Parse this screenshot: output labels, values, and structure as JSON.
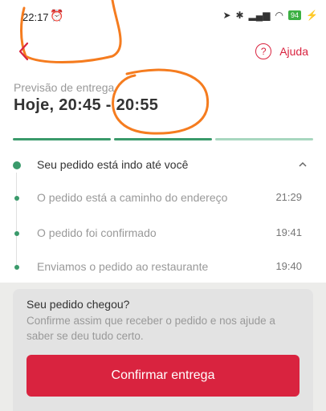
{
  "status_bar": {
    "time": "22:17",
    "battery": "94"
  },
  "header": {
    "help_label": "Ajuda"
  },
  "delivery": {
    "forecast_label": "Previsão de entrega",
    "forecast_time": "Hoje, 20:45 - 20:55"
  },
  "progress": {
    "segments": 3,
    "colors": [
      "#3a9a6b",
      "#3a9a6b",
      "#a8d7bf"
    ]
  },
  "timeline": {
    "current": "Seu pedido está indo até você",
    "steps": [
      {
        "label": "O pedido está a caminho do endereço",
        "time": "21:29"
      },
      {
        "label": "O pedido foi confirmado",
        "time": "19:41"
      },
      {
        "label": "Enviamos o pedido ao restaurante",
        "time": "19:40"
      }
    ]
  },
  "card": {
    "title": "Seu pedido chegou?",
    "description": "Confirme assim que receber o pedido e nos ajude a saber se deu tudo certo.",
    "button_label": "Confirmar entrega"
  },
  "colors": {
    "brand": "#d9233f",
    "success": "#3a9a6b",
    "annotation": "#f57c1f"
  },
  "icons": [
    "back-arrow-icon",
    "help-icon",
    "chevron-up-icon",
    "alarm-icon",
    "signal-icon",
    "wifi-icon",
    "bluetooth-icon",
    "location-icon",
    "battery-icon",
    "charging-icon"
  ]
}
